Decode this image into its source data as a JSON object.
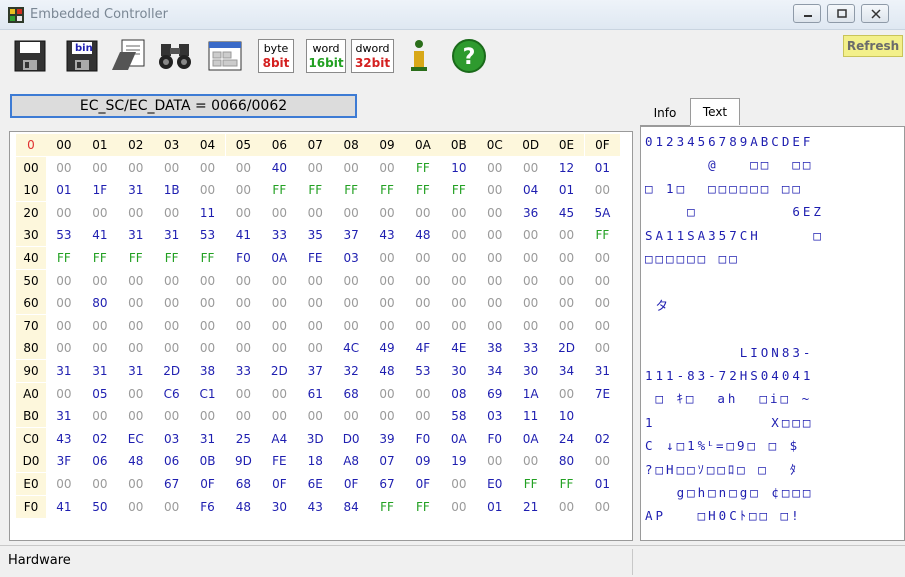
{
  "window": {
    "title": "Embedded Controller"
  },
  "toolbar": {
    "byte_top": "byte",
    "byte_bottom": "8bit",
    "word_top": "word",
    "word_bottom": "16bit",
    "dword_top": "dword",
    "dword_bottom": "32bit",
    "refresh_label": "Refresh",
    "bin_label": "bin",
    "colors": {
      "byte": "#d42020",
      "word": "#22a022",
      "dword": "#d42020"
    }
  },
  "address": {
    "text": "EC_SC/EC_DATA = 0066/0062"
  },
  "hexgrid": {
    "corner": "0",
    "columns": [
      "00",
      "01",
      "02",
      "03",
      "04",
      "05",
      "06",
      "07",
      "08",
      "09",
      "0A",
      "0B",
      "0C",
      "0D",
      "0E",
      "0F"
    ],
    "rows": [
      {
        "label": "00",
        "values": [
          "00",
          "00",
          "00",
          "00",
          "00",
          "00",
          "40",
          "00",
          "00",
          "00",
          "FF",
          "10",
          "00",
          "00",
          "12",
          "01"
        ]
      },
      {
        "label": "10",
        "values": [
          "01",
          "1F",
          "31",
          "1B",
          "00",
          "00",
          "FF",
          "FF",
          "FF",
          "FF",
          "FF",
          "FF",
          "00",
          "04",
          "01",
          "00"
        ]
      },
      {
        "label": "20",
        "values": [
          "00",
          "00",
          "00",
          "00",
          "11",
          "00",
          "00",
          "00",
          "00",
          "00",
          "00",
          "00",
          "00",
          "36",
          "45",
          "5A"
        ]
      },
      {
        "label": "30",
        "values": [
          "53",
          "41",
          "31",
          "31",
          "53",
          "41",
          "33",
          "35",
          "37",
          "43",
          "48",
          "00",
          "00",
          "00",
          "00",
          "FF"
        ]
      },
      {
        "label": "40",
        "values": [
          "FF",
          "FF",
          "FF",
          "FF",
          "FF",
          "F0",
          "0A",
          "FE",
          "03",
          "00",
          "00",
          "00",
          "00",
          "00",
          "00",
          "00"
        ]
      },
      {
        "label": "50",
        "values": [
          "00",
          "00",
          "00",
          "00",
          "00",
          "00",
          "00",
          "00",
          "00",
          "00",
          "00",
          "00",
          "00",
          "00",
          "00",
          "00"
        ]
      },
      {
        "label": "60",
        "values": [
          "00",
          "80",
          "00",
          "00",
          "00",
          "00",
          "00",
          "00",
          "00",
          "00",
          "00",
          "00",
          "00",
          "00",
          "00",
          "00"
        ]
      },
      {
        "label": "70",
        "values": [
          "00",
          "00",
          "00",
          "00",
          "00",
          "00",
          "00",
          "00",
          "00",
          "00",
          "00",
          "00",
          "00",
          "00",
          "00",
          "00"
        ]
      },
      {
        "label": "80",
        "values": [
          "00",
          "00",
          "00",
          "00",
          "00",
          "00",
          "00",
          "00",
          "4C",
          "49",
          "4F",
          "4E",
          "38",
          "33",
          "2D",
          "00"
        ]
      },
      {
        "label": "90",
        "values": [
          "31",
          "31",
          "31",
          "2D",
          "38",
          "33",
          "2D",
          "37",
          "32",
          "48",
          "53",
          "30",
          "34",
          "30",
          "34",
          "31"
        ]
      },
      {
        "label": "A0",
        "values": [
          "00",
          "05",
          "00",
          "C6",
          "C1",
          "00",
          "00",
          "61",
          "68",
          "00",
          "00",
          "08",
          "69",
          "1A",
          "00",
          "7E"
        ]
      },
      {
        "label": "B0",
        "values": [
          "31",
          "00",
          "00",
          "00",
          "00",
          "00",
          "00",
          "00",
          "00",
          "00",
          "00",
          "58",
          "03",
          "11",
          "10"
        ]
      },
      {
        "label": "C0",
        "values": [
          "43",
          "02",
          "EC",
          "03",
          "31",
          "25",
          "A4",
          "3D",
          "D0",
          "39",
          "F0",
          "0A",
          "F0",
          "0A",
          "24",
          "02"
        ]
      },
      {
        "label": "D0",
        "values": [
          "3F",
          "06",
          "48",
          "06",
          "0B",
          "9D",
          "FE",
          "18",
          "A8",
          "07",
          "09",
          "19",
          "00",
          "00",
          "80",
          "00"
        ]
      },
      {
        "label": "E0",
        "values": [
          "00",
          "00",
          "00",
          "67",
          "0F",
          "68",
          "0F",
          "6E",
          "0F",
          "67",
          "0F",
          "00",
          "E0",
          "FF",
          "FF",
          "01"
        ]
      },
      {
        "label": "F0",
        "values": [
          "41",
          "50",
          "00",
          "00",
          "F6",
          "48",
          "30",
          "43",
          "84",
          "FF",
          "FF",
          "00",
          "01",
          "21",
          "00",
          "00"
        ]
      }
    ]
  },
  "tabs": {
    "info": "Info",
    "text": "Text"
  },
  "textview": {
    "header": "0123456789ABCDEF",
    "lines": [
      "      @   □□  □□",
      "□ 1□  □□□□□□ □□",
      "    □         6EZ",
      "SA11SA357CH     □",
      "□□□□□□ □□",
      "",
      " タ",
      "",
      "         LION83-",
      "111-83-72HS04041",
      " □ ｷ□  ah  □i□ ~",
      "1           X□□□",
      "C ↓□1%ᒻ=□9□ □ $",
      "?□H□□ｿ□□ﾛ□ □  ﾀ",
      "   g□h□n□g□ ¢□□□",
      "AP   □H0Cﾄ□□ □!"
    ]
  },
  "status": {
    "text": "Hardware"
  }
}
